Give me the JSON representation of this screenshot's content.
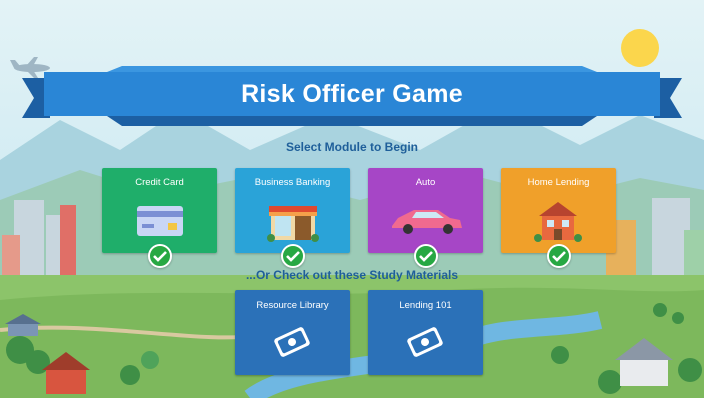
{
  "game": {
    "title": "Risk Officer Game",
    "select_prompt": "Select Module to Begin",
    "study_prompt": "...Or Check out these Study Materials"
  },
  "modules": [
    {
      "label": "Credit Card",
      "color": "#1fae6a",
      "icon": "credit-card-icon",
      "completed": true
    },
    {
      "label": "Business Banking",
      "color": "#2aa3d8",
      "icon": "storefront-icon",
      "completed": true
    },
    {
      "label": "Auto",
      "color": "#a646c6",
      "icon": "car-icon",
      "completed": true
    },
    {
      "label": "Home Lending",
      "color": "#f0a02a",
      "icon": "house-icon",
      "completed": true
    }
  ],
  "study_materials": [
    {
      "label": "Resource Library",
      "icon": "book-icon"
    },
    {
      "label": "Lending 101",
      "icon": "book-icon"
    }
  ],
  "colors": {
    "banner": "#2a86d6",
    "banner_dark": "#1c5fa3",
    "text_blue": "#1f5f9a",
    "check": "#27a843"
  }
}
